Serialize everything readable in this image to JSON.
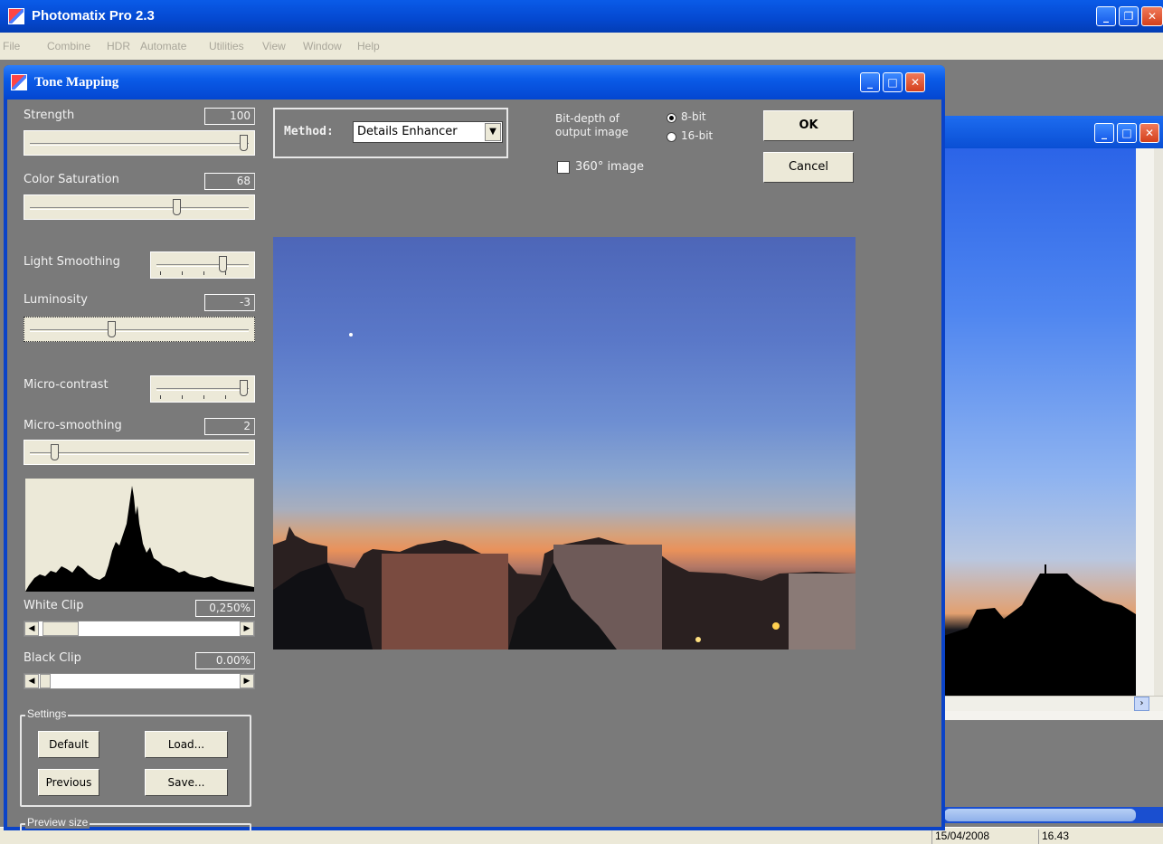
{
  "app": {
    "title": "Photomatix Pro 2.3"
  },
  "menu": [
    "File",
    "Combine",
    "HDR",
    "Automate",
    "Utilities",
    "View",
    "Window",
    "Help"
  ],
  "dialog": {
    "title": "Tone Mapping",
    "sliders": {
      "strength": {
        "label": "Strength",
        "value": "100",
        "level": 1.0
      },
      "color_saturation": {
        "label": "Color Saturation",
        "value": "68",
        "level": 0.68
      },
      "light_smoothing": {
        "label": "Light Smoothing",
        "level": 0.75
      },
      "luminosity": {
        "label": "Luminosity",
        "value": "-3",
        "level": 0.37
      },
      "micro_contrast": {
        "label": "Micro-contrast",
        "level": 1.0
      },
      "micro_smoothing": {
        "label": "Micro-smoothing",
        "value": "2",
        "level": 0.1
      }
    },
    "white_clip": {
      "label": "White Clip",
      "value": "0,250%"
    },
    "black_clip": {
      "label": "Black Clip",
      "value": "0.00%"
    },
    "settings": {
      "label": "Settings",
      "default": "Default",
      "load": "Load...",
      "previous": "Previous",
      "save": "Save..."
    },
    "preview_size_label": "Preview size",
    "method": {
      "label": "Method:",
      "selected": "Details Enhancer"
    },
    "bit_depth": {
      "label_line1": "Bit-depth of",
      "label_line2": "output image",
      "opt8": "8-bit",
      "opt16": "16-bit",
      "selected": "8-bit"
    },
    "image360": {
      "label": "360° image",
      "checked": false
    },
    "ok": "OK",
    "cancel": "Cancel"
  },
  "status": {
    "date": "15/04/2008",
    "time": "16.43"
  },
  "colors": {
    "title_blue": "#0a5be8",
    "dialog_bg": "#7a7a7a",
    "close_red": "#d4401c"
  }
}
